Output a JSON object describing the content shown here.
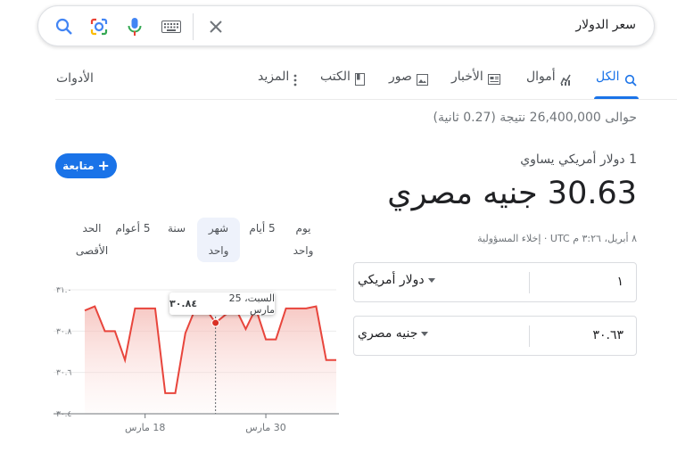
{
  "search": {
    "query": "سعر الدولار"
  },
  "tabs": [
    {
      "label": "الكل",
      "icon": "search-icon",
      "active": true
    },
    {
      "label": "أموال",
      "icon": "finance-icon"
    },
    {
      "label": "الأخبار",
      "icon": "news-icon"
    },
    {
      "label": "صور",
      "icon": "image-icon"
    },
    {
      "label": "الكتب",
      "icon": "book-icon"
    },
    {
      "label": "المزيد",
      "icon": "more-vert-icon"
    }
  ],
  "tools_label": "الأدوات",
  "result_stats": "حوالى 26,400,000 نتيجة (0.27 ثانية)",
  "follow_label": "متابعة",
  "converter": {
    "from_label": "1 دولار أمريكي يساوي",
    "big_result": "30.63 جنيه مصري",
    "timestamp": "٨ أبريل، ٣:٢٦ م UTC · إخلاء المسؤولية",
    "from_value": "١",
    "from_unit": "دولار أمريكي",
    "to_value": "٣٠.٦٣",
    "to_unit": "جنيه مصري"
  },
  "ranges": [
    {
      "line1": "يوم",
      "line2": "واحد"
    },
    {
      "line1": "5 أيام",
      "line2": ""
    },
    {
      "line1": "شهر",
      "line2": "واحد",
      "active": true
    },
    {
      "line1": "سنة",
      "line2": ""
    },
    {
      "line1": "5 أعوام",
      "line2": ""
    },
    {
      "line1": "الحد",
      "line2": "الأقصى"
    }
  ],
  "tooltip": {
    "value": "٣٠.٨٤",
    "date": "السبت، 25 مارس"
  },
  "colors": {
    "accent": "#1a73e8",
    "line": "#e8453c",
    "point": "#d93025"
  },
  "chart_data": {
    "type": "line",
    "ylim": [
      30.4,
      31.0
    ],
    "y_ticks": [
      "٣١.٠",
      "٣٠.٨",
      "٣٠.٦",
      "٣٠.٤"
    ],
    "x_ticks": [
      "18 مارس",
      "30 مارس"
    ],
    "series": [
      {
        "values": [
          30.9,
          30.92,
          30.8,
          30.8,
          30.66,
          30.91,
          30.91,
          30.91,
          30.5,
          30.5,
          30.79,
          30.91,
          30.91,
          30.84,
          30.88,
          30.91,
          30.81,
          30.91,
          30.76,
          30.76,
          30.91,
          30.91,
          30.91,
          30.92,
          30.66,
          30.66
        ]
      }
    ]
  }
}
